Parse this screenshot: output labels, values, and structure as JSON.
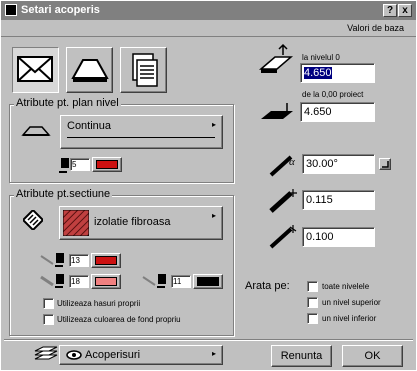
{
  "window": {
    "title": "Setari acoperis",
    "help_glyph": "?",
    "close_glyph": "x"
  },
  "header": {
    "defaults_label": "Valori de baza"
  },
  "plan_group": {
    "legend": "Atribute pt. plan nivel",
    "line_type": "Continua",
    "pen_number": "5",
    "pen_color": "#cc1111"
  },
  "section_group": {
    "legend": "Atribute pt.sectiune",
    "fill_name": "izolatie fibroasa",
    "pen1_number": "13",
    "pen2_number": "18",
    "pen3_number": "11",
    "pen1_color": "#cc1111",
    "pen2_color": "#f08080",
    "pen3_color": "#000000",
    "checkbox_hatch": "Utilizeaza hasuri proprii",
    "checkbox_bg": "Utilizeaza culoarea de fond propriu"
  },
  "right_panel": {
    "level_label": "la nivelul 0",
    "level_value": "4.650",
    "project_label": "de la 0,00 proiect",
    "project_value": "4.650",
    "angle_value": "30.00°",
    "thickness1_value": "0.115",
    "thickness2_value": "0.100",
    "show_on_label": "Arata pe:",
    "opt_all": "toate nivelele",
    "opt_upper": "un nivel superior",
    "opt_lower": "un nivel inferior"
  },
  "footer": {
    "layer_name": "Acoperisuri",
    "cancel_label": "Renunta",
    "ok_label": "OK"
  }
}
